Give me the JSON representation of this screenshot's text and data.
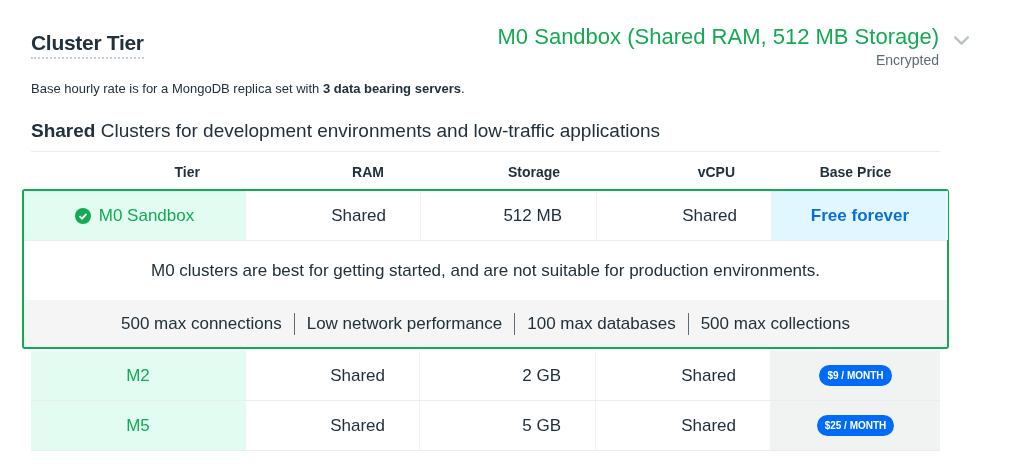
{
  "section": {
    "title": "Cluster Tier",
    "selection": "M0 Sandbox (Shared RAM, 512 MB Storage)",
    "encryption": "Encrypted",
    "expanded": false
  },
  "note": "Base hourly rate is for a MongoDB replica set with **3 data bearing servers**.",
  "group_heading": "**Shared** Clusters for development environments and low-traffic applications",
  "table": {
    "columns": [
      "Tier",
      "RAM",
      "Storage",
      "vCPU",
      "Base Price"
    ],
    "rows": [
      {
        "tier": "M0 Sandbox",
        "ram": "Shared",
        "storage": "512 MB",
        "vcpu": "Shared",
        "price": "Free forever",
        "kind": "text",
        "selected": true,
        "description": "M0 clusters are best for getting started, and are not suitable for production environments.",
        "features": [
          "500 max connections",
          "Low network performance",
          "100 max databases",
          "500 max collections"
        ]
      },
      {
        "tier": "M2",
        "ram": "Shared",
        "storage": "2 GB",
        "vcpu": "Shared",
        "price": "$9 / MONTH",
        "kind": "badge",
        "selected": false
      },
      {
        "tier": "M5",
        "ram": "Shared",
        "storage": "5 GB",
        "vcpu": "Shared",
        "price": "$25 / MONTH",
        "kind": "badge",
        "selected": false
      }
    ]
  }
}
